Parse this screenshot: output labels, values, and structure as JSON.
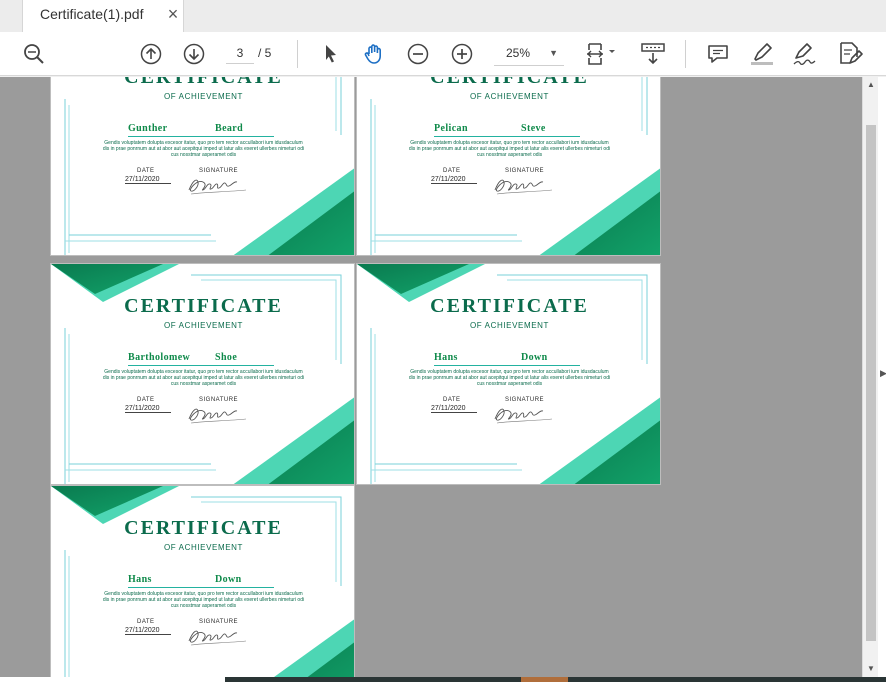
{
  "tab": {
    "title": "Certificate(1).pdf",
    "close": "×"
  },
  "toolbar": {
    "page_current": "3",
    "page_total": "/ 5",
    "zoom": "25%",
    "zoom_dropdown": "▼",
    "icons": [
      "search-icon",
      "page-up-icon",
      "page-down-icon",
      "select-pointer-icon",
      "hand-tool-icon",
      "zoom-out-icon",
      "zoom-in-icon",
      "fit-page-icon",
      "scroll-mode-icon",
      "comment-icon",
      "highlight-icon",
      "sign-icon",
      "fill-sign-icon"
    ]
  },
  "certificates": [
    {
      "title": "CERTIFICATE",
      "subtitle": "OF ACHIEVEMENT",
      "first_name": "Gunther",
      "last_name": "Beard",
      "body": "Gendis voluptatem dolupta excesor itatur, quo pro tem rector accullabori ium idusdaculum dis in prae ponrnum aut at abor aut acepitqui imped ut latur alis exeret ullerbes nimeturi odi cus nosstmar asperamet odis",
      "date_label": "DATE",
      "date": "27/11/2020",
      "signature_label": "SIGNATURE"
    },
    {
      "title": "CERTIFICATE",
      "subtitle": "OF ACHIEVEMENT",
      "first_name": "Pelican",
      "last_name": "Steve",
      "body": "Gendis voluptatem dolupta excesor itatur, quo pro tem rector accullabori ium idusdaculum dis in prae ponrnum aut at abor aut acepitqui imped ut latur alis exeret ullerbes nimeturi odi cus nosstmar asperamet odis",
      "date_label": "DATE",
      "date": "27/11/2020",
      "signature_label": "SIGNATURE"
    },
    {
      "title": "CERTIFICATE",
      "subtitle": "OF ACHIEVEMENT",
      "first_name": "Bartholomew",
      "last_name": "Shoe",
      "body": "Gendis voluptatem dolupta excesor itatur, quo pro tem rector accullabori ium idusdaculum dis in prae ponrnum aut at abor aut acepitqui imped ut latur alis exeret ullerbes nimeturi odi cus nosstmar asperamet odis",
      "date_label": "DATE",
      "date": "27/11/2020",
      "signature_label": "SIGNATURE"
    },
    {
      "title": "CERTIFICATE",
      "subtitle": "OF ACHIEVEMENT",
      "first_name": "Hans",
      "last_name": "Down",
      "body": "Gendis voluptatem dolupta excesor itatur, quo pro tem rector accullabori ium idusdaculum dis in prae ponrnum aut at abor aut acepitqui imped ut latur alis exeret ullerbes nimeturi odi cus nosstmar asperamet odis",
      "date_label": "DATE",
      "date": "27/11/2020",
      "signature_label": "SIGNATURE"
    },
    {
      "title": "CERTIFICATE",
      "subtitle": "OF ACHIEVEMENT",
      "first_name": "Hans",
      "last_name": "Down",
      "body": "Gendis voluptatem dolupta excesor itatur, quo pro tem rector accullabori ium idusdaculum dis in prae ponrnum aut at abor aut acepitqui imped ut latur alis exeret ullerbes nimeturi odi cus nosstmar asperamet odis",
      "date_label": "DATE",
      "date": "27/11/2020",
      "signature_label": "SIGNATURE"
    }
  ],
  "colors": {
    "dark_green": "#0b6b4c",
    "mint": "#4dd6b4",
    "line_teal": "#5fc4cf",
    "viewer_bg": "#9b9b9b"
  }
}
